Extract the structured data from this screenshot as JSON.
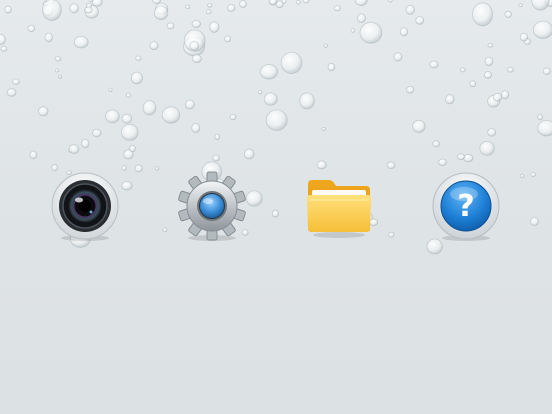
{
  "home_screen": {
    "wallpaper": "water-droplets",
    "apps": [
      {
        "id": "camera",
        "icon": "camera-lens-icon"
      },
      {
        "id": "settings",
        "icon": "gear-icon"
      },
      {
        "id": "files",
        "icon": "folder-icon"
      },
      {
        "id": "help",
        "icon": "question-mark-icon",
        "glyph": "?"
      }
    ]
  },
  "colors": {
    "background": "#e2e6e8",
    "lens_blue": "#3a8fd8",
    "folder_yellow": "#f8c53a",
    "help_blue": "#1d7fd6"
  }
}
